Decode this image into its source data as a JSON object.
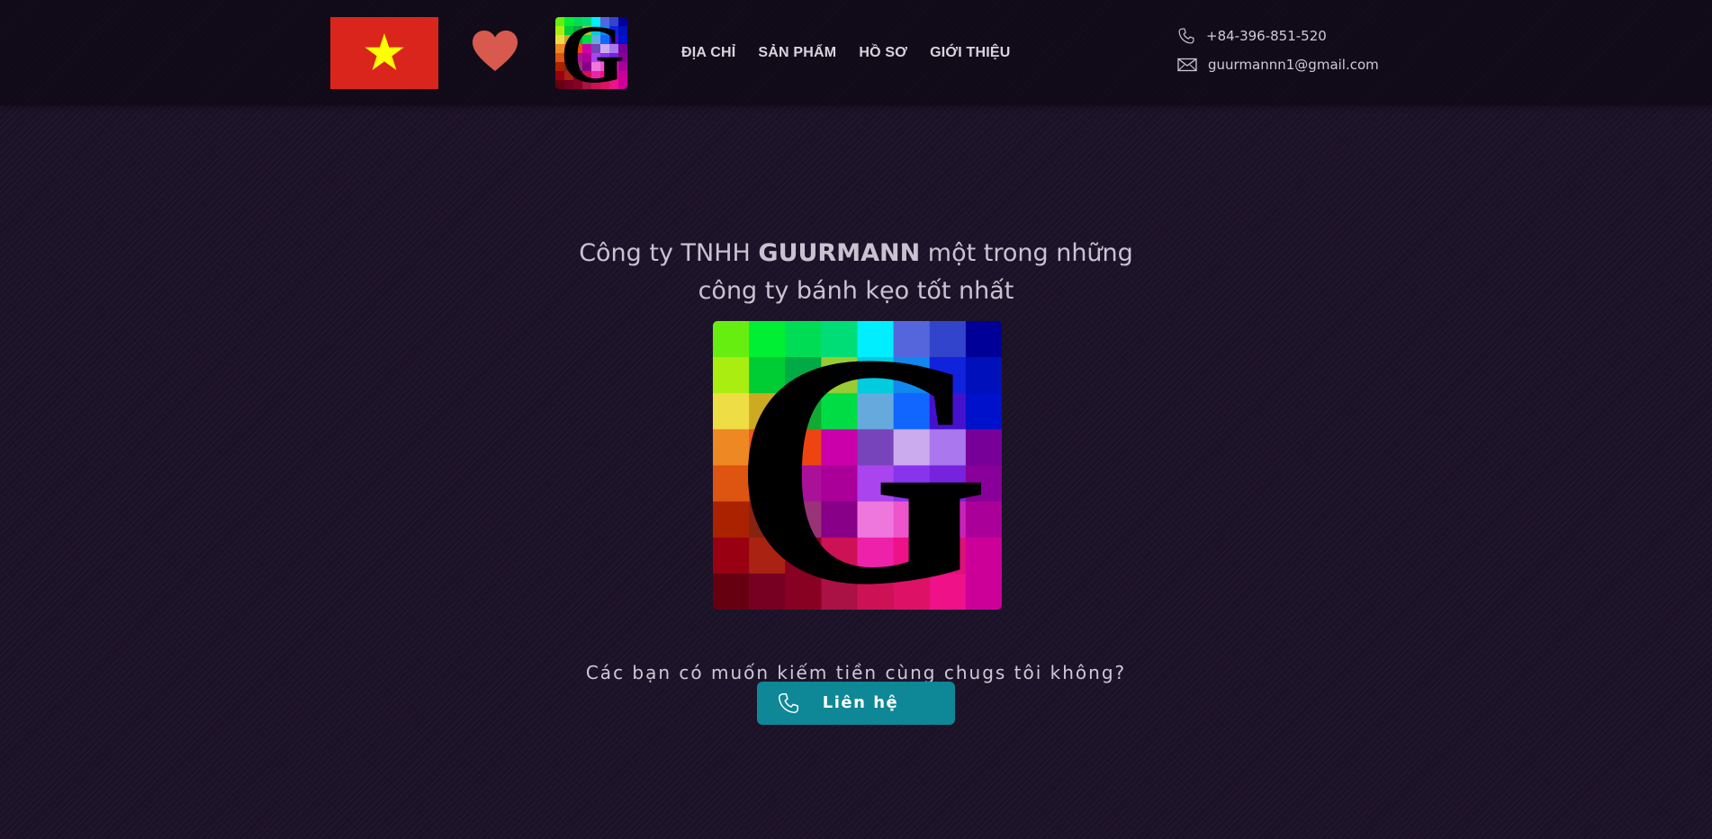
{
  "header": {
    "nav": [
      {
        "label": "ĐỊA CHỈ"
      },
      {
        "label": "SẢN PHẨM"
      },
      {
        "label": "HỒ SƠ"
      },
      {
        "label": "GIỚI THIỆU"
      }
    ],
    "phone": "+84-396-851-520",
    "email": "guurmannn1@gmail.com",
    "icons": {
      "flag": "vietnam-flag-icon",
      "heart": "heart-icon",
      "logo": "guurmann-logo",
      "phone": "phone-icon",
      "email": "mail-icon"
    }
  },
  "hero": {
    "headline_prefix": "Công ty TNHH ",
    "brand": "GUURMANN",
    "headline_suffix": " một trong những",
    "headline_line2": "công ty bánh kẹo tốt nhất",
    "logo_letter": "G",
    "tagline": "Các bạn có muốn kiếm tiền cùng chugs tôi không?",
    "cta_label": "Liên hệ"
  },
  "colors": {
    "background": "#1c1228",
    "flag_red": "#da251d",
    "flag_star": "#ffff00",
    "heart": "#d85a4e",
    "cta": "#0e8797"
  }
}
